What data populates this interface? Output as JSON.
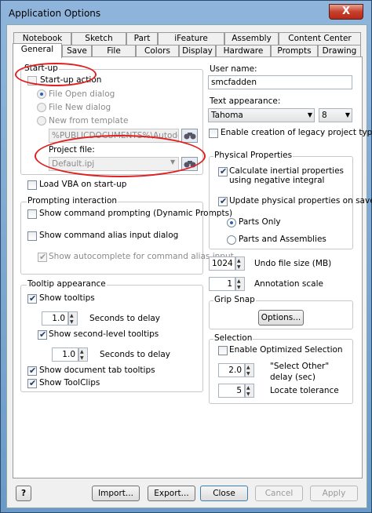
{
  "window": {
    "title": "Application Options",
    "close_glyph": "X"
  },
  "tabs": {
    "row1": [
      "Notebook",
      "Sketch",
      "Part",
      "iFeature",
      "Assembly",
      "Content Center"
    ],
    "row2": [
      "General",
      "Save",
      "File",
      "Colors",
      "Display",
      "Hardware",
      "Prompts",
      "Drawing"
    ],
    "active": "General"
  },
  "startup": {
    "legend": "Start-up",
    "action_label": "Start-up action",
    "open_label": "File Open dialog",
    "new_label": "File New dialog",
    "template_label": "New from template",
    "template_value": "%PUBLICDOCUMENTS%\\Autodesk\\Inv",
    "project_label": "Project file:",
    "project_value": "Default.ipj"
  },
  "load_vba_label": "Load VBA on start-up",
  "prompting": {
    "legend": "Prompting interaction",
    "show_prompting": "Show command prompting (Dynamic Prompts)",
    "show_alias": "Show command alias input dialog",
    "show_autocomplete": "Show autocomplete for command alias input"
  },
  "tooltip": {
    "legend": "Tooltip appearance",
    "show_tooltips": "Show tooltips",
    "delay1_value": "1.0",
    "delay1_label": "Seconds to delay",
    "show_second": "Show second-level tooltips",
    "delay2_value": "1.0",
    "delay2_label": "Seconds to delay",
    "show_doc_tab": "Show document tab tooltips",
    "show_toolclips": "Show ToolClips"
  },
  "user": {
    "label": "User name:",
    "value": "smcfadden"
  },
  "text_appearance": {
    "label": "Text appearance:",
    "font": "Tahoma",
    "size": "8",
    "legacy_label": "Enable creation of legacy project types"
  },
  "physical": {
    "legend": "Physical Properties",
    "calc_label": "Calculate inertial properties using negative integral",
    "update_label": "Update physical properties on save",
    "parts_only": "Parts Only",
    "parts_assemblies": "Parts and Assemblies"
  },
  "undo": {
    "value": "1024",
    "label": "Undo file size (MB)"
  },
  "annotation": {
    "value": "1",
    "label": "Annotation scale"
  },
  "grip": {
    "legend": "Grip Snap",
    "options_label": "Options..."
  },
  "selection": {
    "legend": "Selection",
    "optimized_label": "Enable Optimized Selection",
    "select_other_value": "2.0",
    "select_other_label_1": "\"Select Other\"",
    "select_other_label_2": "delay (sec)",
    "locate_value": "5",
    "locate_label": "Locate tolerance"
  },
  "footer": {
    "help_glyph": "?",
    "import_label": "Import...",
    "export_label": "Export...",
    "close_label": "Close",
    "cancel_label": "Cancel",
    "apply_label": "Apply"
  }
}
